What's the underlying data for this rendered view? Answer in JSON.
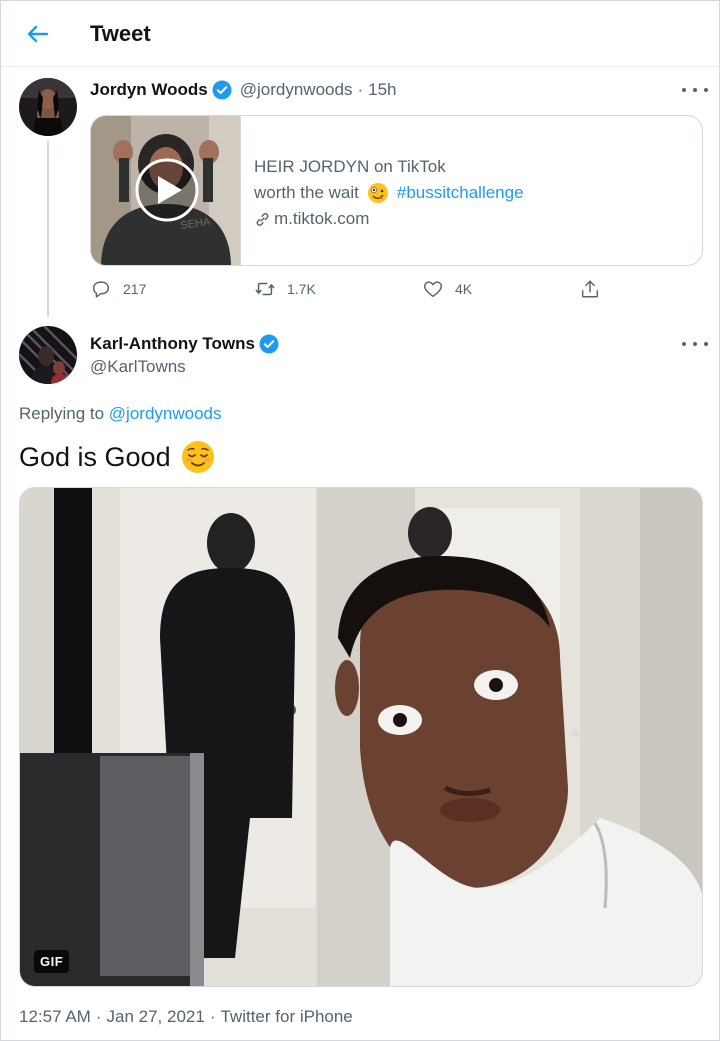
{
  "header": {
    "title": "Tweet",
    "back_icon": "arrow-left-icon"
  },
  "original_tweet": {
    "display_name": "Jordyn Woods",
    "handle": "@jordynwoods",
    "separator": "·",
    "time": "15h",
    "verified": true,
    "card": {
      "title": "HEIR JORDYN on TikTok",
      "desc_prefix": "worth the wait",
      "emoji": "zany-face",
      "hashtag": "#bussitchallenge",
      "link": "m.tiktok.com",
      "play_icon": "play-icon",
      "hoodie_text": "SEHA"
    },
    "actions": {
      "replies": "217",
      "retweets": "1.7K",
      "likes": "4K"
    }
  },
  "reply_tweet": {
    "display_name": "Karl-Anthony Towns",
    "handle": "@KarlTowns",
    "verified": true,
    "replying_prefix": "Replying to",
    "replying_to": "@jordynwoods",
    "text": "God is Good",
    "emoji": "relieved-face",
    "media_badge": "GIF",
    "timestamp_time": "12:57 AM",
    "timestamp_date": "Jan 27, 2021",
    "source": "Twitter for iPhone",
    "separator": "·"
  },
  "colors": {
    "accent": "#1d9bf0",
    "text": "#0f1419",
    "secondary": "#536471",
    "border": "#cfd9de"
  }
}
